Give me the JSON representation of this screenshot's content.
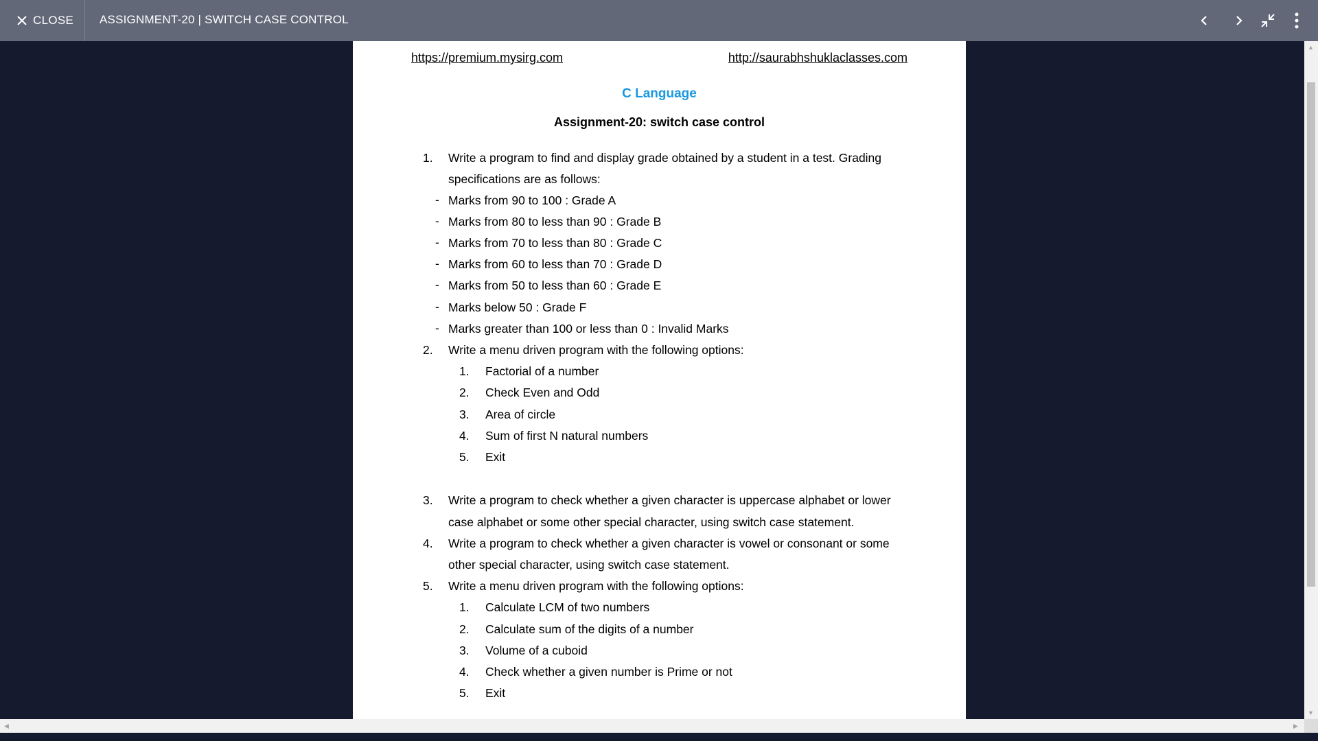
{
  "toolbar": {
    "close_label": "CLOSE",
    "title": "ASSIGNMENT-20 | SWITCH CASE CONTROL",
    "icons": [
      "prev-icon",
      "next-icon",
      "exit-fullscreen-icon",
      "more-vert-icon"
    ]
  },
  "document": {
    "link_left": "https://premium.mysirg.com",
    "link_right": "http://saurabhshuklaclasses.com",
    "subject": "C Language",
    "heading": "Assignment-20: switch case control",
    "q1_num": "1.",
    "q1_line1": "Write a program to find and display grade obtained by a student in a test. Grading",
    "q1_line2": "specifications are as follows:",
    "grades": [
      "Marks from 90 to 100 : Grade A",
      "Marks from 80 to less than 90 : Grade B",
      "Marks from 70 to less than 80 : Grade C",
      "Marks from 60 to less than 70 : Grade D",
      "Marks from 50 to less than 60 : Grade E",
      "Marks below 50 : Grade F",
      "Marks greater than 100 or less than 0 : Invalid Marks"
    ],
    "q2_num": "2.",
    "q2_text": "Write a menu driven program with the following options:",
    "q2_options": [
      "Factorial of a number",
      "Check Even and Odd",
      "Area of circle",
      "Sum of first N natural numbers",
      "Exit"
    ],
    "q3_num": "3.",
    "q3_line1": "Write a program to check whether a given character is uppercase alphabet or lower",
    "q3_line2": "case alphabet or some other special character, using switch case statement.",
    "q4_num": "4.",
    "q4_line1": "Write a program to check whether a given character is vowel or consonant or some",
    "q4_line2": "other special character, using switch case statement.",
    "q5_num": "5.",
    "q5_text": "Write a menu driven program with the following options:",
    "q5_options": [
      "Calculate LCM of two numbers",
      "Calculate sum of the digits of a number",
      "Volume of a cuboid",
      "Check whether a given number is Prime or not",
      "Exit"
    ],
    "sub_numbers": [
      "1.",
      "2.",
      "3.",
      "4.",
      "5."
    ]
  },
  "colors": {
    "toolbar_bg": "#626878",
    "viewer_bg": "#161a2e",
    "subject_color": "#1a98e0"
  }
}
